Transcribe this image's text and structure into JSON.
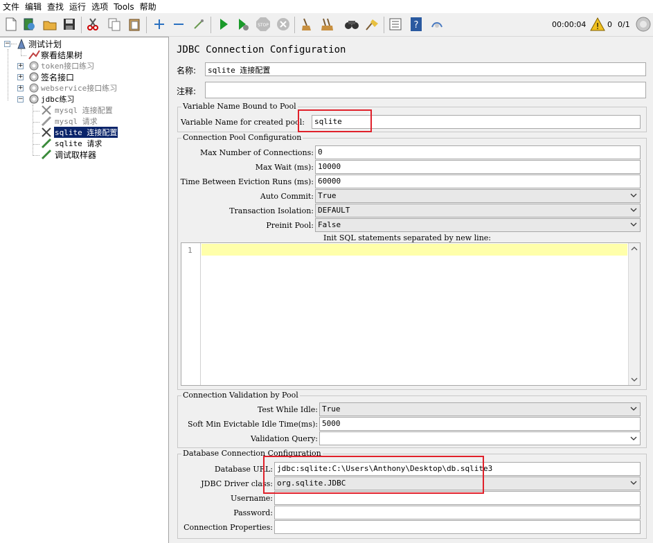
{
  "menu": [
    "文件",
    "编辑",
    "查找",
    "运行",
    "选项",
    "Tools",
    "帮助"
  ],
  "toolbar": {
    "icons": [
      "new-icon",
      "templates-icon",
      "open-icon",
      "save-icon",
      "cut-icon",
      "copy-icon",
      "paste-icon",
      "expand-icon",
      "collapse-icon",
      "toggle-icon",
      "start-icon",
      "start-no-pause-icon",
      "stop-icon",
      "shutdown-icon",
      "clear-icon",
      "clear-all-icon",
      "search-icon",
      "reset-search-icon",
      "function-helper-icon",
      "help-icon",
      "remote-icon"
    ],
    "elapsed": "00:00:04",
    "warnings": "0",
    "threads": "0/1"
  },
  "tree": {
    "nodes": [
      {
        "label": "测试计划",
        "icon": "test-plan-icon",
        "disabled": false,
        "selected": false,
        "mono": false
      },
      {
        "label": "察看结果树",
        "icon": "listener-icon",
        "disabled": false,
        "selected": false,
        "mono": false
      },
      {
        "label": "token接口练习",
        "icon": "thread-group-icon",
        "disabled": true,
        "selected": false,
        "mono": true
      },
      {
        "label": "签名接口",
        "icon": "thread-group-icon",
        "disabled": false,
        "selected": false,
        "mono": false
      },
      {
        "label": "webservice接口练习",
        "icon": "thread-group-icon",
        "disabled": true,
        "selected": false,
        "mono": true
      },
      {
        "label": "jdbc练习",
        "icon": "thread-group-icon",
        "disabled": false,
        "selected": false,
        "mono": true
      },
      {
        "label": "mysql 连接配置",
        "icon": "config-element-icon",
        "disabled": true,
        "selected": false,
        "mono": true
      },
      {
        "label": "mysql 请求",
        "icon": "sampler-icon",
        "disabled": true,
        "selected": false,
        "mono": true
      },
      {
        "label": "sqlite 连接配置",
        "icon": "config-element-icon",
        "disabled": false,
        "selected": true,
        "mono": true
      },
      {
        "label": "sqlite 请求",
        "icon": "sampler-icon",
        "disabled": false,
        "selected": false,
        "mono": true
      },
      {
        "label": "调试取样器",
        "icon": "sampler-icon",
        "disabled": false,
        "selected": false,
        "mono": false
      }
    ]
  },
  "panel": {
    "title": "JDBC Connection Configuration",
    "name_label": "名称:",
    "name_value": "sqlite 连接配置",
    "comment_label": "注释:",
    "comment_value": "",
    "var_group": {
      "title": "Variable Name Bound to Pool",
      "var_label": "Variable Name for created pool:",
      "var_value": "sqlite"
    },
    "pool_group": {
      "title": "Connection Pool Configuration",
      "max_conn_label": "Max Number of Connections:",
      "max_conn_value": "0",
      "max_wait_label": "Max Wait (ms):",
      "max_wait_value": "10000",
      "eviction_label": "Time Between Eviction Runs (ms):",
      "eviction_value": "60000",
      "auto_commit_label": "Auto Commit:",
      "auto_commit_value": "True",
      "isolation_label": "Transaction Isolation:",
      "isolation_value": "DEFAULT",
      "preinit_label": "Preinit Pool:",
      "preinit_value": "False",
      "init_sql_label": "Init SQL statements separated by new line:",
      "line_number": "1"
    },
    "validation_group": {
      "title": "Connection Validation by Pool",
      "test_idle_label": "Test While Idle:",
      "test_idle_value": "True",
      "soft_min_label": "Soft Min Evictable Idle Time(ms):",
      "soft_min_value": "5000",
      "validation_query_label": "Validation Query:",
      "validation_query_value": ""
    },
    "db_group": {
      "title": "Database Connection Configuration",
      "url_label": "Database URL:",
      "url_value": "jdbc:sqlite:C:\\Users\\Anthony\\Desktop\\db.sqlite3",
      "driver_label": "JDBC Driver class:",
      "driver_value": "org.sqlite.JDBC",
      "username_label": "Username:",
      "username_value": "",
      "password_label": "Password:",
      "password_value": "",
      "props_label": "Connection Properties:",
      "props_value": ""
    }
  },
  "colors": {
    "highlight_box": "#e0202a",
    "selection": "#0a246a",
    "current_line": "#ffffaa"
  }
}
